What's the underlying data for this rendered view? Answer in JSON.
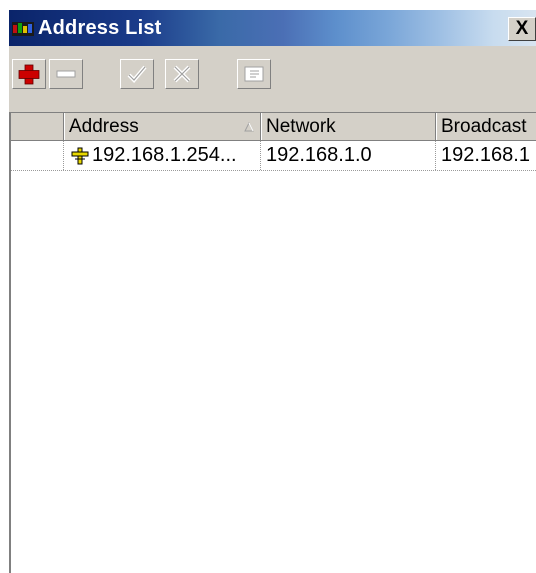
{
  "window": {
    "title": "Address List",
    "close_label": "X"
  },
  "toolbar": {
    "buttons": [
      {
        "name": "add",
        "icon": "plus-icon",
        "enabled": true
      },
      {
        "name": "remove",
        "icon": "minus-icon",
        "enabled": false
      },
      {
        "name": "enable",
        "icon": "check-icon",
        "enabled": false
      },
      {
        "name": "disable",
        "icon": "x-icon",
        "enabled": false
      },
      {
        "name": "comment",
        "icon": "comment-icon",
        "enabled": false
      }
    ]
  },
  "list": {
    "columns": [
      {
        "label": ""
      },
      {
        "label": "Address",
        "sorted": "ascending"
      },
      {
        "label": "Network"
      },
      {
        "label": "Broadcast"
      }
    ],
    "rows": [
      {
        "flag": "",
        "icon": "address-plus-icon",
        "address": "192.168.1.254...",
        "network": "192.168.1.0",
        "broadcast": "192.168.1"
      }
    ]
  },
  "colors": {
    "title_gradient_start": "#0a246a",
    "add_icon": "#cc0000",
    "address_icon": "#e8d800",
    "window_bg": "#d4d0c8"
  }
}
